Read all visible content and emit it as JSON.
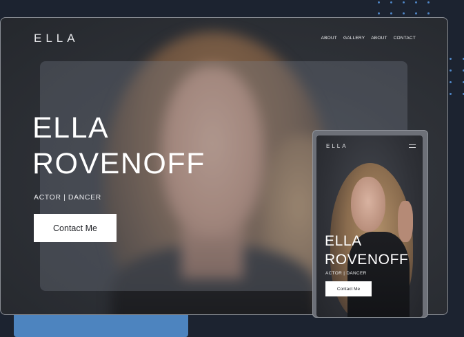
{
  "desktop": {
    "logo": "ELLA",
    "nav": [
      "ABOUT",
      "GALLERY",
      "ABOUT",
      "CONTACT"
    ],
    "hero": {
      "title_line1": "ELLA",
      "title_line2": "ROVENOFF",
      "subtitle": "ACTOR | DANCER",
      "button_label": "Contact Me"
    }
  },
  "mobile": {
    "logo": "ELLA",
    "menu_icon": "hamburger-icon",
    "hero": {
      "title_line1": "ELLA",
      "title_line2": "ROVENOFF",
      "subtitle": "ACTOR | DANCER",
      "button_label": "Contact Me"
    }
  },
  "colors": {
    "background": "#1c2330",
    "accent_blue": "#4d84bf",
    "dots": "#4f86c6",
    "button_bg": "#ffffff",
    "text_light": "#ffffff"
  }
}
